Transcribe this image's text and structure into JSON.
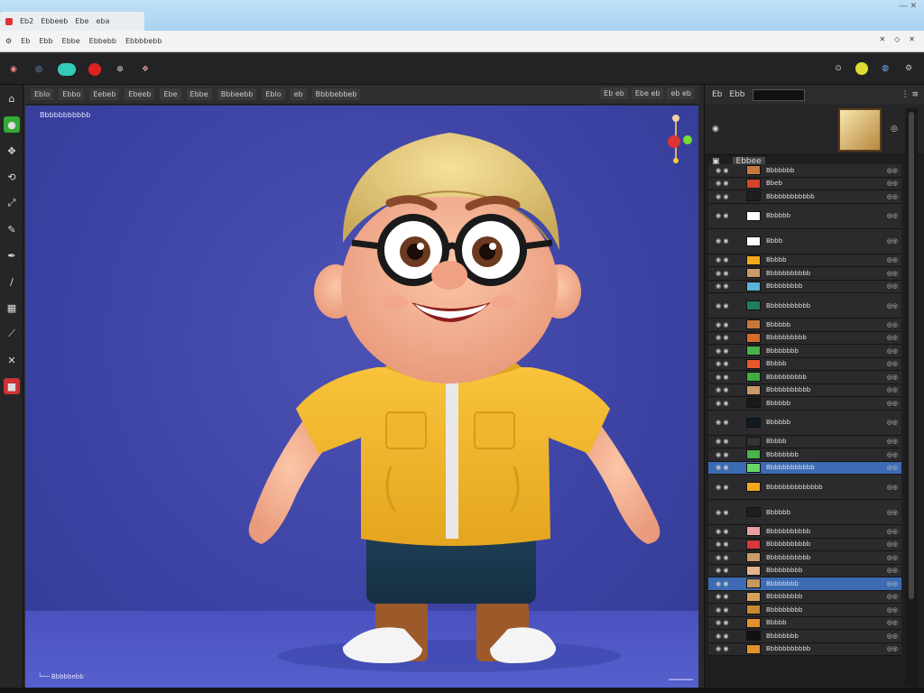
{
  "window": {
    "tabs": [
      "Eb2",
      "Ebbeeb",
      "Ebe",
      "eba"
    ],
    "controls": "― ✕"
  },
  "menubar": {
    "items": [
      "Eb",
      "Ebb",
      "Ebbe",
      "Ebbebb",
      "Ebbbbebb"
    ],
    "right": [
      "✕",
      "◇",
      "✕"
    ]
  },
  "viewport": {
    "header_left": [
      "Eblo",
      "Ebbo",
      "Eebeb",
      "Ebeeb",
      "Ebe",
      "Ebbe",
      "Bbbeebb",
      "Eblo",
      "eb",
      "Bbbbebbeb"
    ],
    "header_right": [
      "Eb eb",
      "Ebe eb",
      "eb eb"
    ],
    "object_name": "Bbbbbbbbbbb",
    "footer": "└── Bbbbbebb"
  },
  "right_panel": {
    "header": [
      "Eb",
      "Ebb"
    ],
    "list_header": "Ebbee",
    "layers": [
      {
        "name": "Bbbbbbb",
        "color": "#c8773a"
      },
      {
        "name": "Bbeb",
        "color": "#d5452b",
        "selected": false
      },
      {
        "name": "Bbbbbbbbbbbb",
        "color": "#1f1f1f"
      },
      {
        "name": "Bbbbbb",
        "color": "#ffffff",
        "tall": true
      },
      {
        "name": "Bbbb",
        "color": "#ffffff",
        "tall": true
      },
      {
        "name": "Bbbbb",
        "color": "#f2a81b"
      },
      {
        "name": "Bbbbbbbbbbb",
        "color": "#c99b6a"
      },
      {
        "name": "Bbbbbbbbb",
        "color": "#5ab3d8"
      },
      {
        "name": "Bbbbbbbbbbb",
        "color": "#1f7e5d",
        "tall": true
      },
      {
        "name": "Bbbbbb",
        "color": "#c8773a"
      },
      {
        "name": "Bbbbbbbbbb",
        "color": "#d86b2b"
      },
      {
        "name": "Bbbbbbbb",
        "color": "#4ab24a"
      },
      {
        "name": "Bbbbb",
        "color": "#e5582c"
      },
      {
        "name": "Bbbbbbbbbb",
        "color": "#3fae3f"
      },
      {
        "name": "Bbbbbbbbbbb",
        "color": "#c99b6a"
      },
      {
        "name": "Bbbbbb",
        "color": "#1a1a1a"
      },
      {
        "name": "Bbbbbb",
        "color": "#0f1a24",
        "tall": true
      },
      {
        "name": "Bbbbb",
        "color": "#333333"
      },
      {
        "name": "Bbbbbbbb",
        "color": "#4ab24a"
      },
      {
        "name": "Bbbbbbbbbbbb",
        "color": "#6ad66a",
        "selected": true
      },
      {
        "name": "Bbbbbbbbbbbbbb",
        "color": "#f2a81b",
        "tall": true
      },
      {
        "name": "Bbbbbb",
        "color": "#1f1f1f",
        "tall": true
      },
      {
        "name": "Bbbbbbbbbbb",
        "color": "#e8a0a0"
      },
      {
        "name": "Bbbbbbbbbbb",
        "color": "#d9383a"
      },
      {
        "name": "Bbbbbbbbbbb",
        "color": "#c99b6a"
      },
      {
        "name": "Bbbbbbbbb",
        "color": "#e5b48e"
      },
      {
        "name": "Bbbbbbbb",
        "color": "#c89660",
        "selected": true
      },
      {
        "name": "Bbbbbbbbb",
        "color": "#d9a25b"
      },
      {
        "name": "Bbbbbbbbb",
        "color": "#c78a2d"
      },
      {
        "name": "Bbbbb",
        "color": "#e5902b"
      },
      {
        "name": "Bbbbbbbb",
        "color": "#111111"
      },
      {
        "name": "Bbbbbbbbbbb",
        "color": "#e5902b"
      }
    ]
  }
}
